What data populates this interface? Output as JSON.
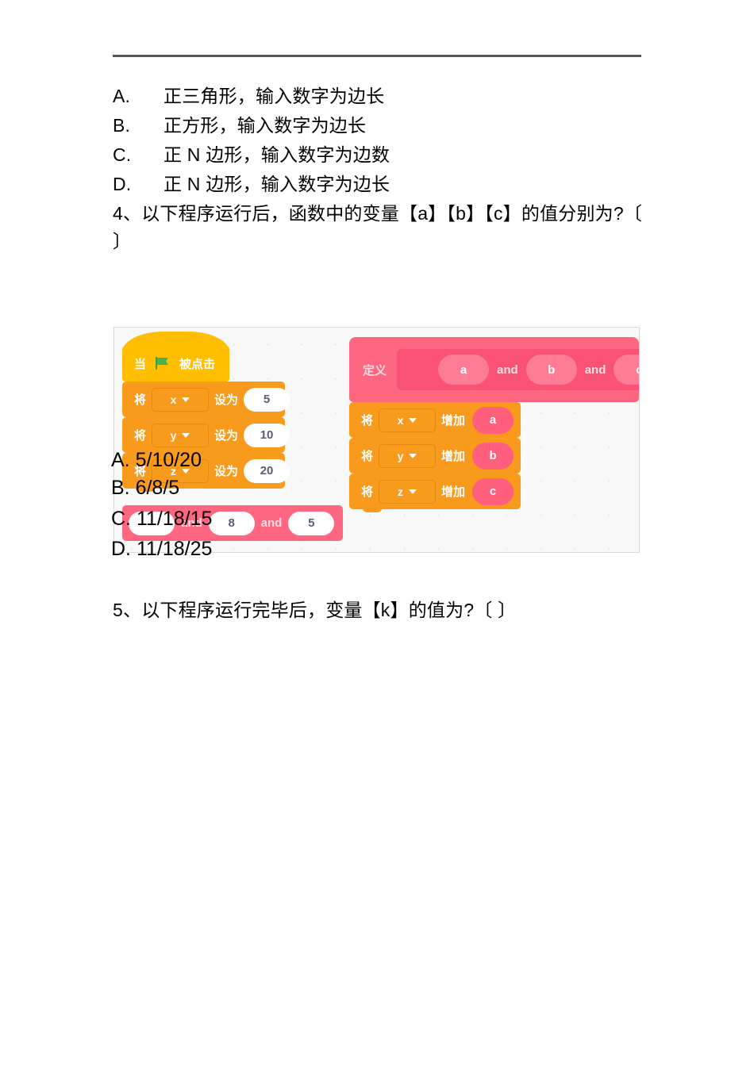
{
  "document": {
    "choices_q3": [
      {
        "marker": "A.",
        "text": "正三角形，输入数字为边长"
      },
      {
        "marker": "B.",
        "text": "正方形，输入数字为边长"
      },
      {
        "marker": "C.",
        "text": "正 N 边形，输入数字为边数"
      },
      {
        "marker": "D.",
        "text": "正 N 边形，输入数字为边长"
      }
    ],
    "question4": "4、以下程序运行后，函数中的变量【a】【b】【c】的值分别为?〔 〕",
    "question4_options": [
      "A. 5/10/20",
      "B. 6/8/5",
      "C. 11/18/15",
      "D. 11/18/25"
    ],
    "question5": "5、以下程序运行完毕后，变量【k】的值为?〔 〕"
  },
  "scratch": {
    "colors": {
      "events_yellow": "#ffbf00",
      "variables_orange": "#f89a1c",
      "myblocks_pink": "#ff6680",
      "myblocks_dark": "#fa5274",
      "canvas_bg": "#f8f8f8"
    },
    "left_stack": {
      "hat": {
        "when": "当",
        "icon": "green-flag-icon",
        "clicked": "被点击"
      },
      "set_blocks": [
        {
          "verb": "将",
          "variable": "x",
          "to": "设为",
          "value": "5"
        },
        {
          "verb": "将",
          "variable": "y",
          "to": "设为",
          "value": "10"
        },
        {
          "verb": "将",
          "variable": "z",
          "to": "设为",
          "value": "20"
        }
      ],
      "call_block": {
        "arg1": "",
        "and1": "and",
        "arg2": "8",
        "and2": "and",
        "arg3": "5"
      }
    },
    "right_stack": {
      "define": {
        "label": "定义",
        "args": [
          "a",
          "b",
          "c"
        ],
        "separator": "and"
      },
      "change_blocks": [
        {
          "verb": "将",
          "variable": "x",
          "by": "增加",
          "value": "a"
        },
        {
          "verb": "将",
          "variable": "y",
          "by": "增加",
          "value": "b"
        },
        {
          "verb": "将",
          "variable": "z",
          "by": "增加",
          "value": "c"
        }
      ]
    }
  }
}
